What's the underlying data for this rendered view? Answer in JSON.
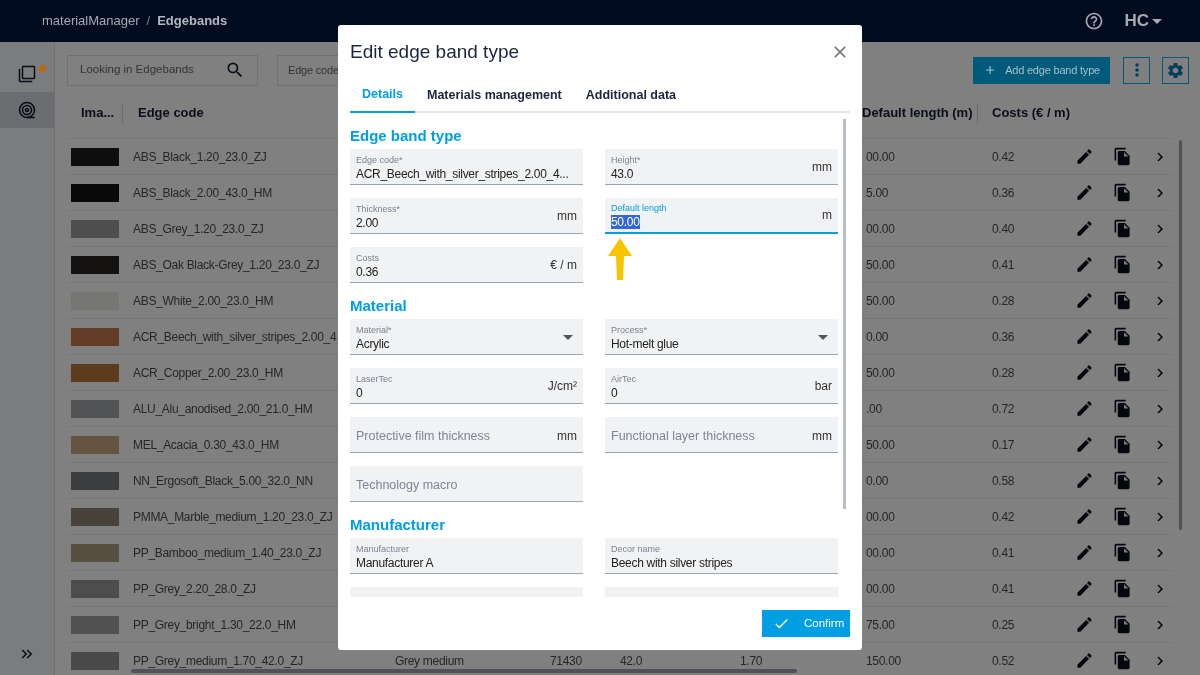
{
  "header": {
    "breadcrumb": [
      "materialManager",
      "Edgebands"
    ],
    "separator": "/",
    "logo": "HC"
  },
  "sidebar": {
    "items": [
      {
        "kind": "windows",
        "selected": false,
        "notification": true
      },
      {
        "kind": "roll",
        "selected": true,
        "notification": false
      }
    ]
  },
  "toolbar": {
    "search": {
      "placeholder": "Looking in Edgebands"
    },
    "filter": {
      "placeholder": "Edge code"
    },
    "add_button": "Add edge band type"
  },
  "table": {
    "columns": [
      "Ima...",
      "Edge code",
      "Default length (m)",
      "Costs (€ / m)"
    ],
    "rows": [
      {
        "color": "#0e0e0f",
        "edge_code": "ABS_Black_1.20_23.0_ZJ",
        "default_length": "00.00",
        "costs": "0.42"
      },
      {
        "color": "#0a0a0b",
        "edge_code": "ABS_Black_2.00_43.0_HM",
        "default_length": "5.00",
        "costs": "0.36"
      },
      {
        "color": "#4e4e4f",
        "edge_code": "ABS_Grey_1.20_23.0_ZJ",
        "default_length": "00.00",
        "costs": "0.40"
      },
      {
        "color": "#151311",
        "edge_code": "ABS_Oak Black-Grey_1.20_23.0_ZJ",
        "default_length": "50.00",
        "costs": "0.41"
      },
      {
        "color": "#767673",
        "edge_code": "ABS_White_2.00_23.0_HM",
        "default_length": "50.00",
        "costs": "0.28"
      },
      {
        "color": "#623c24",
        "edge_code": "ACR_Beech_with_silver_stripes_2.00_4",
        "default_length": "0.00",
        "costs": "0.36"
      },
      {
        "color": "#5c3c1c",
        "edge_code": "ACR_Copper_2.00_23.0_HM",
        "default_length": "50.00",
        "costs": "0.28"
      },
      {
        "color": "#525355",
        "edge_code": "ALU_Alu_anodised_2.00_21.0_HM",
        "default_length": ".00",
        "costs": "0.72"
      },
      {
        "color": "#655440",
        "edge_code": "MEL_Acacia_0.30_43.0_HM",
        "default_length": "50.00",
        "costs": "0.17"
      },
      {
        "color": "#3d3e40",
        "edge_code": "NN_Ergosoft_Black_5.00_32.0_NN",
        "default_length": "0.00",
        "costs": "0.58"
      },
      {
        "color": "#47423a",
        "edge_code": "PMMA_Marble_medium_1.20_23.0_ZJ",
        "default_length": "00.00",
        "costs": "0.42"
      },
      {
        "color": "#574f42",
        "edge_code": "PP_Bamboo_medium_1.40_23.0_ZJ",
        "default_length": "00.00",
        "costs": "0.41"
      },
      {
        "color": "#4d4d4d",
        "edge_code": "PP_Grey_2.20_28.0_ZJ",
        "default_length": "00.00",
        "costs": "0.41"
      },
      {
        "color": "#515151",
        "edge_code": "PP_Grey_bright_1.30_22.0_HM",
        "default_length": "75.00",
        "costs": "0.25"
      },
      {
        "color": "#494949",
        "edge_code": "PP_Grey_medium_1.70_42.0_ZJ",
        "column_3": "Grey medium",
        "column_4": "71430",
        "column_5": "42.0",
        "column_6": "1.70",
        "default_length": "150.00",
        "costs": "0.52"
      }
    ]
  },
  "dialog": {
    "title": "Edit edge band type",
    "tabs": [
      {
        "label": "Details",
        "selected": true
      },
      {
        "label": "Materials management",
        "selected": false
      },
      {
        "label": "Additional data",
        "selected": false
      }
    ],
    "sections": [
      {
        "title": "Edge band type",
        "fields": [
          {
            "kind": "text",
            "label": "Edge code*",
            "value": "ACR_Beech_with_silver_stripes_2.00_4...",
            "focused": false
          },
          {
            "kind": "text",
            "label": "Height*",
            "value": "43.0",
            "unit": "mm",
            "focused": false
          },
          {
            "kind": "text",
            "label": "Thickness*",
            "value": "2.00",
            "unit": "mm",
            "focused": false
          },
          {
            "kind": "text",
            "label": "Default length",
            "value": "50.00",
            "unit": "m",
            "focused": true
          },
          {
            "kind": "text",
            "label": "Costs",
            "value": "0.36",
            "unit": "€ / m",
            "focused": false
          }
        ]
      },
      {
        "title": "Material",
        "fields": [
          {
            "kind": "select",
            "label": "Material*",
            "value": "Acrylic",
            "focused": false
          },
          {
            "kind": "select",
            "label": "Process*",
            "value": "Hot-melt glue",
            "focused": false
          },
          {
            "kind": "text",
            "label": "LaserTec",
            "value": "0",
            "unit": "J/cm²",
            "focused": false
          },
          {
            "kind": "text",
            "label": "AirTec",
            "value": "0",
            "unit": "bar",
            "focused": false
          },
          {
            "kind": "text",
            "placeholder": "Protective film thickness",
            "unit": "mm",
            "focused": false
          },
          {
            "kind": "text",
            "placeholder": "Functional layer thickness",
            "unit": "mm",
            "focused": false
          },
          {
            "kind": "text",
            "placeholder": "Technology macro",
            "focused": false
          }
        ]
      },
      {
        "title": "Manufacturer",
        "fields": [
          {
            "kind": "text",
            "label": "Manufacturer",
            "value": "Manufacturer A",
            "focused": false
          },
          {
            "kind": "text",
            "label": "Decor name",
            "value": "Beech with silver stripes",
            "focused": false
          },
          {
            "kind": "blank"
          },
          {
            "kind": "blank"
          }
        ]
      }
    ],
    "confirm_button": "Confirm"
  }
}
